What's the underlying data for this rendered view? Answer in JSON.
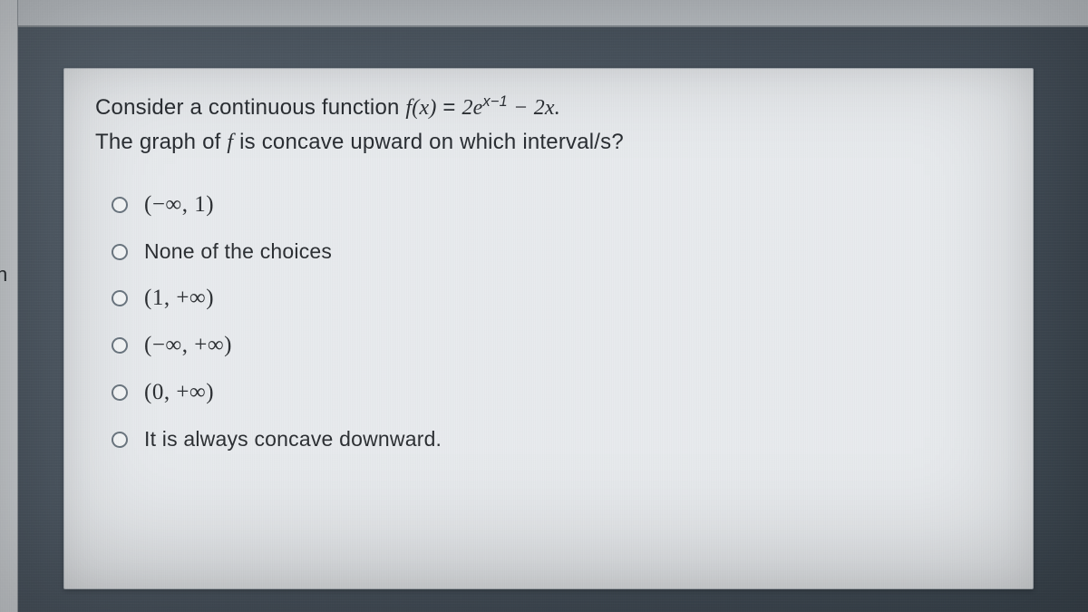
{
  "left_edge_letter": "n",
  "question": {
    "line1_prefix": "Consider a continuous function ",
    "func_lhs": "f(x)",
    "eq": " = ",
    "rhs_a": "2e",
    "rhs_exp": "x−1",
    "rhs_b": " − 2x.",
    "line2_prefix": "The graph of ",
    "line2_f": "f",
    "line2_suffix": " is concave upward on which interval/s?"
  },
  "choices": [
    {
      "type": "math",
      "label": "(−∞, 1)"
    },
    {
      "type": "text",
      "label": "None of the choices"
    },
    {
      "type": "math",
      "label": "(1, +∞)"
    },
    {
      "type": "math",
      "label": "(−∞, +∞)"
    },
    {
      "type": "math",
      "label": "(0, +∞)"
    },
    {
      "type": "text",
      "label": "It is always concave downward."
    }
  ]
}
